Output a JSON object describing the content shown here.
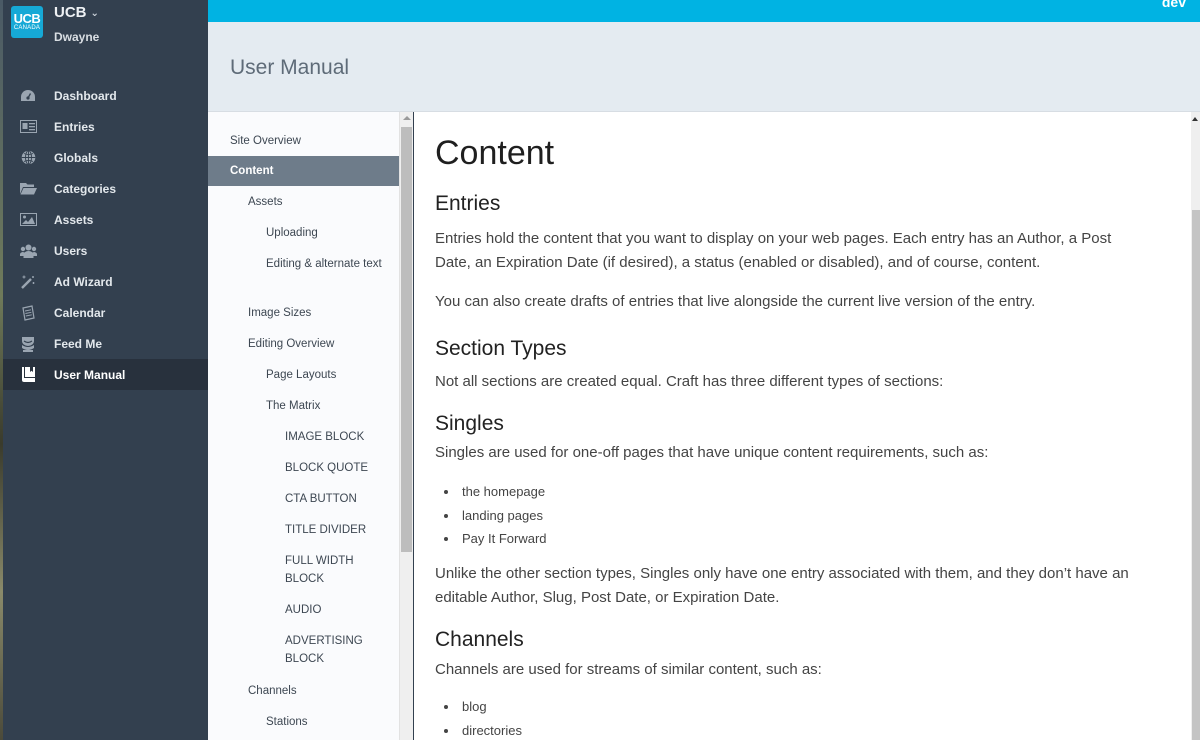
{
  "environment": "dev",
  "brand": {
    "logo_line1": "UCB",
    "logo_line2": "CANADA",
    "site_name": "UCB",
    "user_name": "Dwayne"
  },
  "sidebar": {
    "items": [
      {
        "label": "Dashboard",
        "icon": "dashboard-icon",
        "active": false
      },
      {
        "label": "Entries",
        "icon": "entries-icon",
        "active": false
      },
      {
        "label": "Globals",
        "icon": "globe-icon",
        "active": false
      },
      {
        "label": "Categories",
        "icon": "folder-icon",
        "active": false
      },
      {
        "label": "Assets",
        "icon": "image-icon",
        "active": false
      },
      {
        "label": "Users",
        "icon": "users-icon",
        "active": false
      },
      {
        "label": "Ad Wizard",
        "icon": "magic-wand-icon",
        "active": false
      },
      {
        "label": "Calendar",
        "icon": "calendar-icon",
        "active": false
      },
      {
        "label": "Feed Me",
        "icon": "feed-me-icon",
        "active": false
      },
      {
        "label": "User Manual",
        "icon": "book-icon",
        "active": true
      }
    ]
  },
  "page": {
    "title": "User Manual"
  },
  "manual_tree": {
    "items": [
      {
        "label": "Site Overview",
        "level": 0,
        "active": false
      },
      {
        "label": "Content",
        "level": 0,
        "active": true
      },
      {
        "label": "Assets",
        "level": 1,
        "active": false
      },
      {
        "label": "Uploading",
        "level": 2,
        "active": false
      },
      {
        "label": "Editing & alternate text",
        "level": 2,
        "active": false
      },
      {
        "label": "Image Sizes",
        "level": 1,
        "active": false
      },
      {
        "label": "Editing Overview",
        "level": 1,
        "active": false
      },
      {
        "label": "Page Layouts",
        "level": 2,
        "active": false
      },
      {
        "label": "The Matrix",
        "level": 2,
        "active": false
      },
      {
        "label": "IMAGE BLOCK",
        "level": 3,
        "active": false
      },
      {
        "label": "BLOCK QUOTE",
        "level": 3,
        "active": false
      },
      {
        "label": "CTA BUTTON",
        "level": 3,
        "active": false
      },
      {
        "label": "TITLE DIVIDER",
        "level": 3,
        "active": false
      },
      {
        "label": "FULL WIDTH BLOCK",
        "level": 3,
        "active": false
      },
      {
        "label": "AUDIO",
        "level": 3,
        "active": false
      },
      {
        "label": "ADVERTISING BLOCK",
        "level": 3,
        "active": false
      },
      {
        "label": "Channels",
        "level": 1,
        "active": false
      },
      {
        "label": "Stations",
        "level": 2,
        "active": false
      }
    ]
  },
  "content": {
    "title": "Content",
    "entries_heading": "Entries",
    "entries_p1": "Entries hold the content that you want to display on your web pages. Each entry has an Author, a Post Date, an Expiration Date (if desired), a status (enabled or disabled), and of course, content.",
    "entries_p2": "You can also create drafts of entries that live alongside the current live version of the entry.",
    "section_types_heading": "Section Types",
    "section_types_p": "Not all sections are created equal. Craft has three different types of sections:",
    "singles_heading": "Singles",
    "singles_p1": "Singles are used for one-off pages that have unique content requirements, such as:",
    "singles_list": [
      "the homepage",
      "landing pages",
      "Pay It Forward"
    ],
    "singles_p2": "Unlike the other section types, Singles only have one entry associated with them, and they don’t have an editable Author, Slug, Post Date, or Expiration Date.",
    "channels_heading": "Channels",
    "channels_p1": "Channels are used for streams of similar content, such as:",
    "channels_list": [
      "blog",
      "directories"
    ]
  }
}
